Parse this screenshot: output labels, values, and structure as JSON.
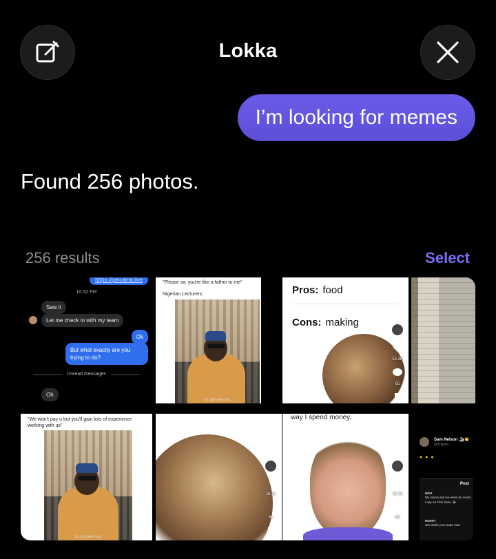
{
  "header": {
    "title": "Lokka",
    "compose_icon": "compose-icon",
    "close_icon": "close-icon"
  },
  "chat": {
    "user_message": "I’m looking for memes",
    "assistant_reply": "Found 256 photos."
  },
  "results": {
    "count_label": "256 results",
    "select_label": "Select"
  },
  "tiles": {
    "chat_screenshot": {
      "link": "https://getcama.live",
      "time": "10:32 PM",
      "msg1": "Saw it",
      "msg2": "Let me check in with my team",
      "msg3": "Ok",
      "msg4": "But what exactly are you trying to do?",
      "divider": "Unread messages",
      "msg5": "Oh"
    },
    "nigerian_lecturers": {
      "caption1": "\"Please sir, you're like a father to me\"",
      "caption2": "Nigerian Lecturers:",
      "watermark": "IG: @mattesi.mp"
    },
    "pros_cons": {
      "pros_label": "Pros:",
      "pros_value": "food",
      "cons_label": "Cons:",
      "cons_value": "making",
      "likes": "15.3K",
      "comments": "65",
      "saves": "913"
    },
    "experience_meme": {
      "caption": "\"We won't pay u but you'll gain lots of experience working with us\"",
      "watermark": "IG: @mattesi.mp"
    },
    "spend_money": {
      "caption": "way I spend money."
    },
    "face_tile_counts": {
      "likes": "16.3k",
      "comments": "66"
    },
    "tweet": {
      "name": "Sam Nelson 🏂👏",
      "handle": "@Trigsiel",
      "post_label": "Post",
      "reply1_name": "HEIS",
      "reply1_handle": "@heis_keebah · 8h",
      "reply1_text": "My mama ask me wetin be result..",
      "reply1_text2": "I say na First class. 😂",
      "reply2_name": "HENRY",
      "reply2_handle": "@enrycrypt · 8h",
      "reply2_text": "Sex wetin your papa marr"
    }
  },
  "colors": {
    "accent": "#6a5ce8",
    "select": "#7b6cf6",
    "background": "#000000"
  }
}
